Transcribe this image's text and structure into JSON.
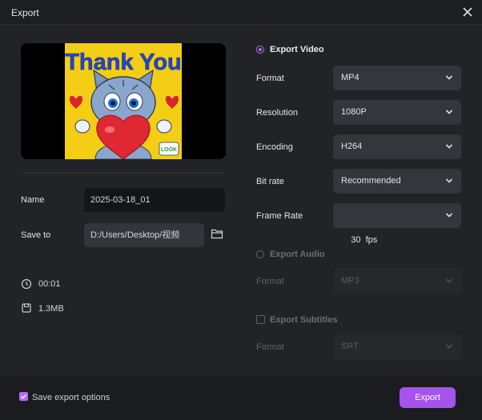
{
  "window": {
    "title": "Export"
  },
  "preview": {
    "image_text": "Thank You",
    "badge_text": "LOOK"
  },
  "file": {
    "name_label": "Name",
    "name_value": "2025-03-18_01",
    "save_label": "Save to",
    "save_value": "D:/Users/Desktop/视频",
    "duration": "00:01",
    "size": "1.3MB"
  },
  "video": {
    "title": "Export Video",
    "selected": true,
    "rows": [
      {
        "label": "Format",
        "value": "MP4"
      },
      {
        "label": "Resolution",
        "value": "1080P"
      },
      {
        "label": "Encoding",
        "value": "H264"
      },
      {
        "label": "Bit rate",
        "value": "Recommended"
      },
      {
        "label": "Frame Rate",
        "value": "30  fps"
      }
    ]
  },
  "audio": {
    "title": "Export Audio",
    "selected": false,
    "format_label": "Format",
    "format_value": "MP3"
  },
  "subtitles": {
    "title": "Export Subtitles",
    "checked": false,
    "format_label": "Format",
    "format_value": "SRT"
  },
  "footer": {
    "save_options_label": "Save export options",
    "save_options_checked": true,
    "export_label": "Export"
  },
  "colors": {
    "accent": "#a553ec",
    "background": "#222327",
    "field": "#35363b"
  }
}
